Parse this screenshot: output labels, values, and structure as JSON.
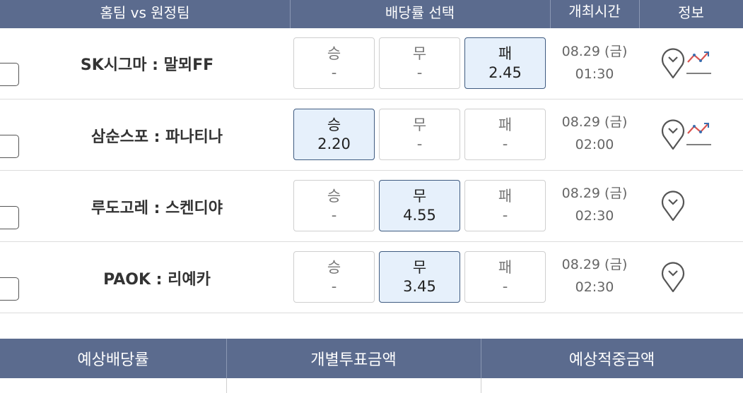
{
  "header": {
    "col_match": "홈팀 vs 원정팀",
    "col_odds": "배당률 선택",
    "col_time": "개최시간",
    "col_info": "정보"
  },
  "matches": [
    {
      "name": "SK시그마 : 말뫼FF",
      "win": {
        "label": "승",
        "value": "-"
      },
      "draw": {
        "label": "무",
        "value": "-"
      },
      "lose": {
        "label": "패",
        "value": "2.45"
      },
      "selected": "lose",
      "date": "08.29 (금)",
      "time": "01:30",
      "has_chart": true
    },
    {
      "name": "삼순스포 : 파나티나",
      "win": {
        "label": "승",
        "value": "2.20"
      },
      "draw": {
        "label": "무",
        "value": "-"
      },
      "lose": {
        "label": "패",
        "value": "-"
      },
      "selected": "win",
      "date": "08.29 (금)",
      "time": "02:00",
      "has_chart": true
    },
    {
      "name": "루도고레 : 스켄디야",
      "win": {
        "label": "승",
        "value": "-"
      },
      "draw": {
        "label": "무",
        "value": "4.55"
      },
      "lose": {
        "label": "패",
        "value": "-"
      },
      "selected": "draw",
      "date": "08.29 (금)",
      "time": "02:30",
      "has_chart": false
    },
    {
      "name": "PAOK : 리예카",
      "win": {
        "label": "승",
        "value": "-"
      },
      "draw": {
        "label": "무",
        "value": "3.45"
      },
      "lose": {
        "label": "패",
        "value": "-"
      },
      "selected": "draw",
      "date": "08.29 (금)",
      "time": "02:30",
      "has_chart": false
    }
  ],
  "summary": {
    "expected_odds": "예상배당률",
    "individual_amount": "개별투표금액",
    "expected_win_amount": "예상적중금액"
  },
  "colors": {
    "header_bg": "#5b6b8e",
    "selected_bg": "#e6f0fb",
    "selected_border": "#3f5b80"
  }
}
